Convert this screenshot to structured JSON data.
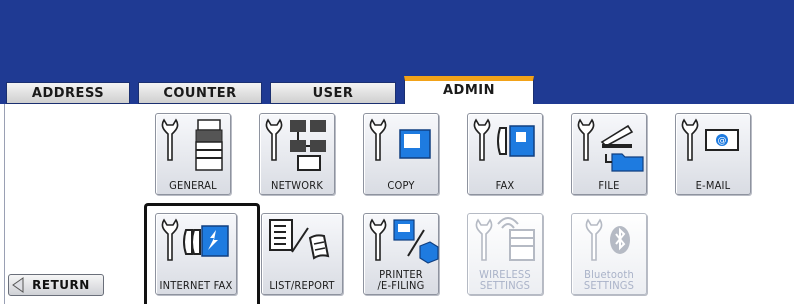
{
  "tabs": [
    {
      "label": "ADDRESS"
    },
    {
      "label": "COUNTER"
    },
    {
      "label": "USER"
    },
    {
      "label": "ADMIN",
      "active": true
    }
  ],
  "buttons_row1": [
    {
      "label": "GENERAL",
      "icon": "wrench-printer-icon"
    },
    {
      "label": "NETWORK",
      "icon": "wrench-network-icon"
    },
    {
      "label": "COPY",
      "icon": "wrench-copy-icon"
    },
    {
      "label": "FAX",
      "icon": "wrench-fax-icon"
    },
    {
      "label": "FILE",
      "icon": "wrench-file-icon"
    },
    {
      "label": "E-MAIL",
      "icon": "wrench-email-icon"
    }
  ],
  "buttons_row2": [
    {
      "label": "INTERNET FAX",
      "icon": "wrench-internet-fax-icon",
      "selected": true
    },
    {
      "label": "LIST/REPORT",
      "icon": "list-report-icon"
    },
    {
      "label_line1": "PRINTER",
      "label_line2": "/E-FILING",
      "icon": "wrench-printer-efiling-icon"
    },
    {
      "label_line1": "WIRELESS",
      "label_line2": "SETTINGS",
      "icon": "wrench-wireless-icon",
      "disabled": true
    },
    {
      "label_line1": "Bluetooth",
      "label_line2": "SETTINGS",
      "icon": "wrench-bluetooth-icon",
      "disabled": true
    }
  ],
  "return_button": {
    "label": "RETURN"
  },
  "colors": {
    "header": "#1f3a93",
    "active_tab_accent": "#f2a218",
    "icon_blue": "#1e7be0"
  }
}
